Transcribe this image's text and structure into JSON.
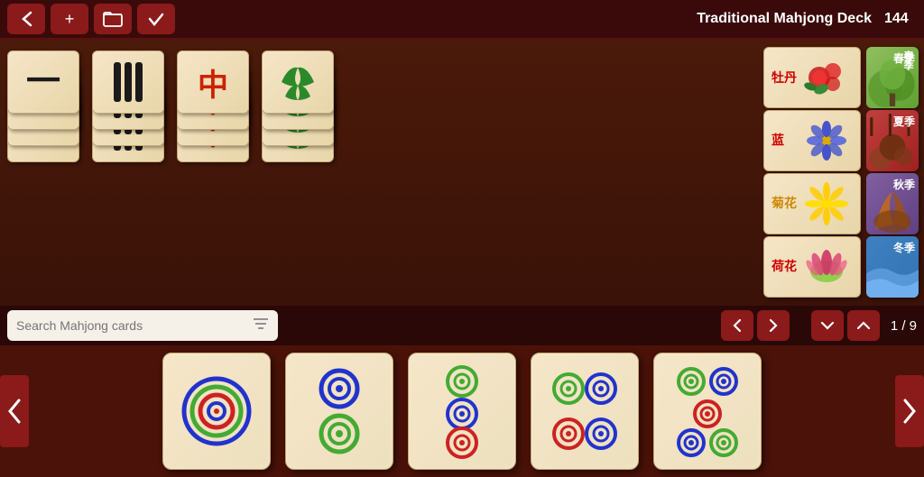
{
  "topbar": {
    "back_label": "←",
    "add_label": "+",
    "folder_label": "🗂",
    "check_label": "✓",
    "deck_title": "Traditional Mahjong Deck",
    "card_count": "144"
  },
  "navbar": {
    "search_placeholder": "Search Mahjong cards",
    "prev_label": "‹",
    "next_label": "›",
    "scroll_down_label": "⌄",
    "scroll_up_label": "⌃",
    "page_indicator": "1 / 9"
  },
  "tray": {
    "left_arrow": "❮",
    "right_arrow": "❯"
  },
  "columns": [
    {
      "symbol": "一\n二\n三",
      "type": "wan",
      "color": "black"
    },
    {
      "symbol": "II\nII\nII",
      "type": "bamboo",
      "color": "black"
    },
    {
      "symbol": "中\n中\n中\n中",
      "type": "dragon-red",
      "color": "red"
    },
    {
      "symbol": "♣\n♣\n♣\n♣",
      "type": "bamboo-green",
      "color": "green"
    }
  ],
  "flowers": [
    {
      "text": "牡丹",
      "type": "peony"
    },
    {
      "text": "蓝花",
      "type": "blue-flower"
    },
    {
      "text": "菊花",
      "type": "chrysanthemum"
    },
    {
      "text": "荷花",
      "type": "lotus"
    }
  ],
  "seasons": [
    {
      "label": "春季",
      "bg": 1
    },
    {
      "label": "夏季",
      "bg": 2
    },
    {
      "label": "秋季",
      "bg": 3
    },
    {
      "label": "冬季",
      "bg": 4
    }
  ],
  "tray_cards": [
    {
      "circles": "1dot"
    },
    {
      "circles": "2dot"
    },
    {
      "circles": "3dot"
    },
    {
      "circles": "4dot"
    },
    {
      "circles": "5dot"
    }
  ]
}
